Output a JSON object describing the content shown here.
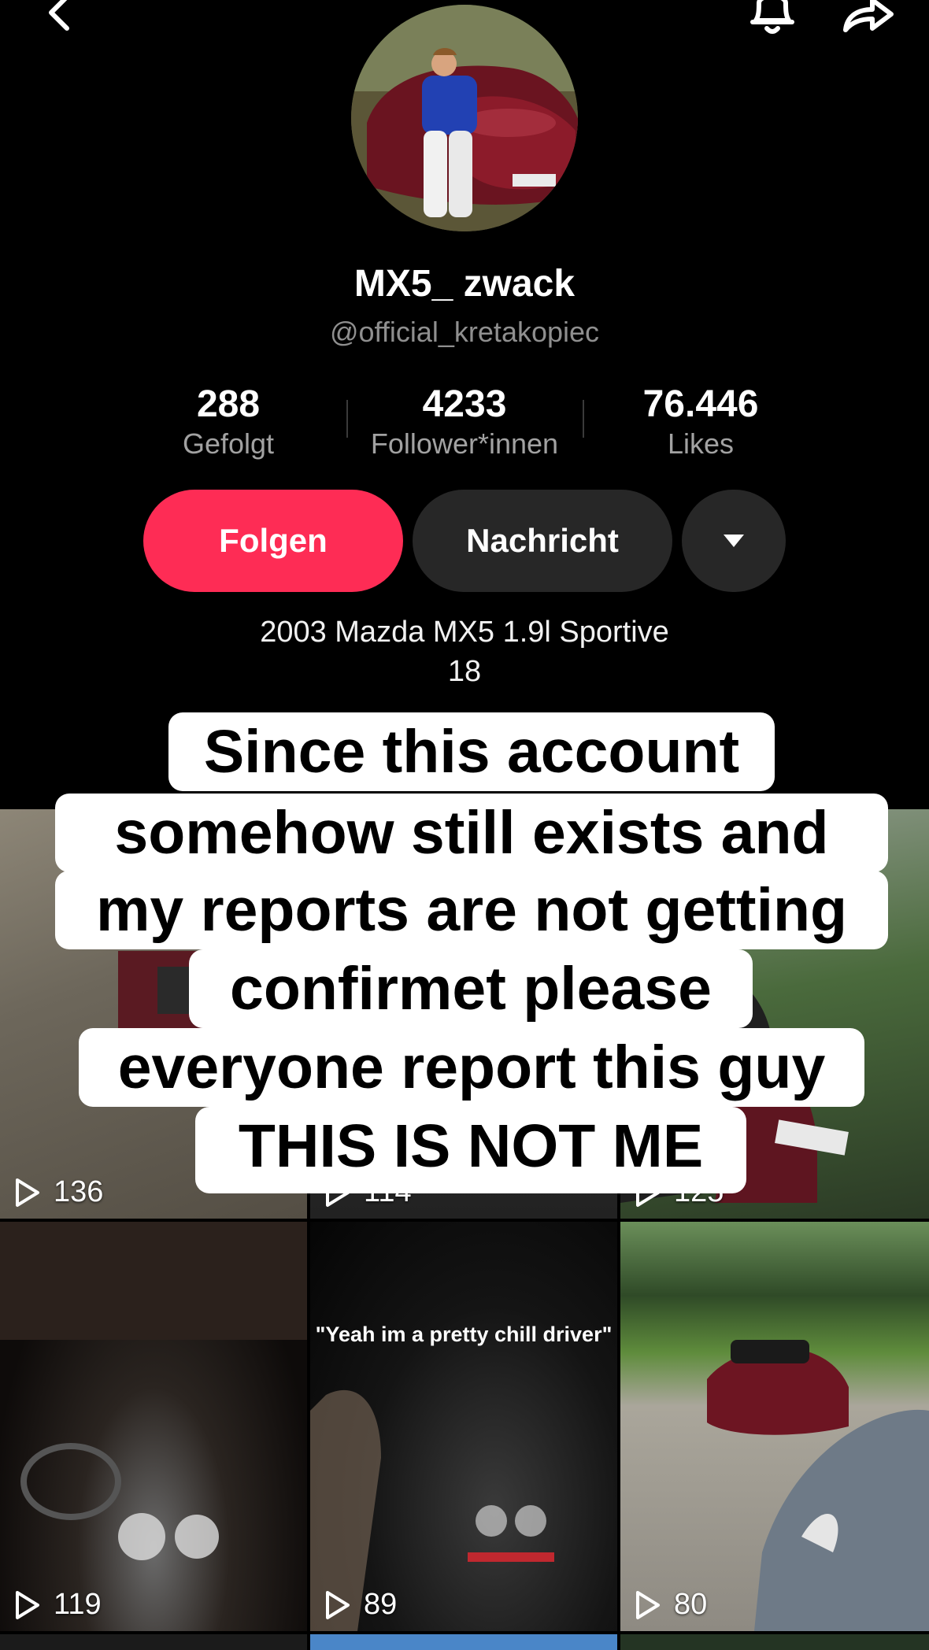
{
  "header": {
    "back_icon": "chevron-left-icon",
    "bell_icon": "bell-icon",
    "share_icon": "share-arrow-icon"
  },
  "profile": {
    "display_name": "MX5_ zwack",
    "handle": "@official_kretakopiec",
    "stats": [
      {
        "value": "288",
        "label": "Gefolgt"
      },
      {
        "value": "4233",
        "label": "Follower*innen"
      },
      {
        "value": "76.446",
        "label": "Likes"
      }
    ],
    "buttons": {
      "follow": "Folgen",
      "message": "Nachricht"
    },
    "bio_line_1": "2003 Mazda MX5 1.9l  Sportive",
    "bio_line_2": "18"
  },
  "overlay_caption": [
    "Since this account",
    "somehow still exists and",
    "my reports are not getting",
    "confirmet please",
    "everyone report this guy",
    "THIS IS NOT ME"
  ],
  "videos": [
    {
      "views": "136"
    },
    {
      "views": "114"
    },
    {
      "views": "125"
    },
    {
      "views": "119"
    },
    {
      "views": "89",
      "caption": "\"Yeah im a pretty chill driver\""
    },
    {
      "views": "80"
    }
  ],
  "colors": {
    "background": "#000000",
    "follow_button": "#fe2c55",
    "secondary_button": "#272727"
  }
}
